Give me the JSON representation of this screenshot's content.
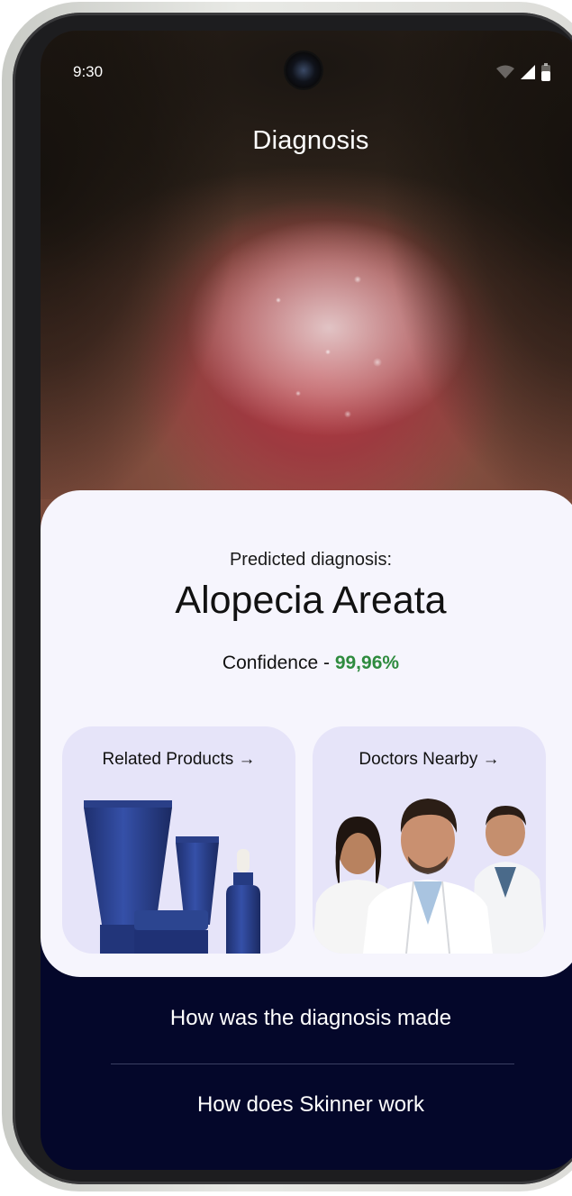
{
  "status_bar": {
    "time": "9:30"
  },
  "header": {
    "title": "Diagnosis"
  },
  "result": {
    "label": "Predicted diagnosis:",
    "diagnosis": "Alopecia Areata",
    "confidence_label": "Confidence - ",
    "confidence_value": "99,96%",
    "confidence_color": "#2e8b3e"
  },
  "tiles": {
    "products": {
      "label": "Related Products",
      "arrow": "→"
    },
    "doctors": {
      "label": "Doctors Nearby",
      "arrow": "→"
    }
  },
  "links": {
    "how_diagnosis": "How was the diagnosis made",
    "how_skinner": "How does Skinner work"
  },
  "colors": {
    "background_dark": "#04072a",
    "card": "#f6f5fd",
    "tile": "#e6e4f9"
  }
}
